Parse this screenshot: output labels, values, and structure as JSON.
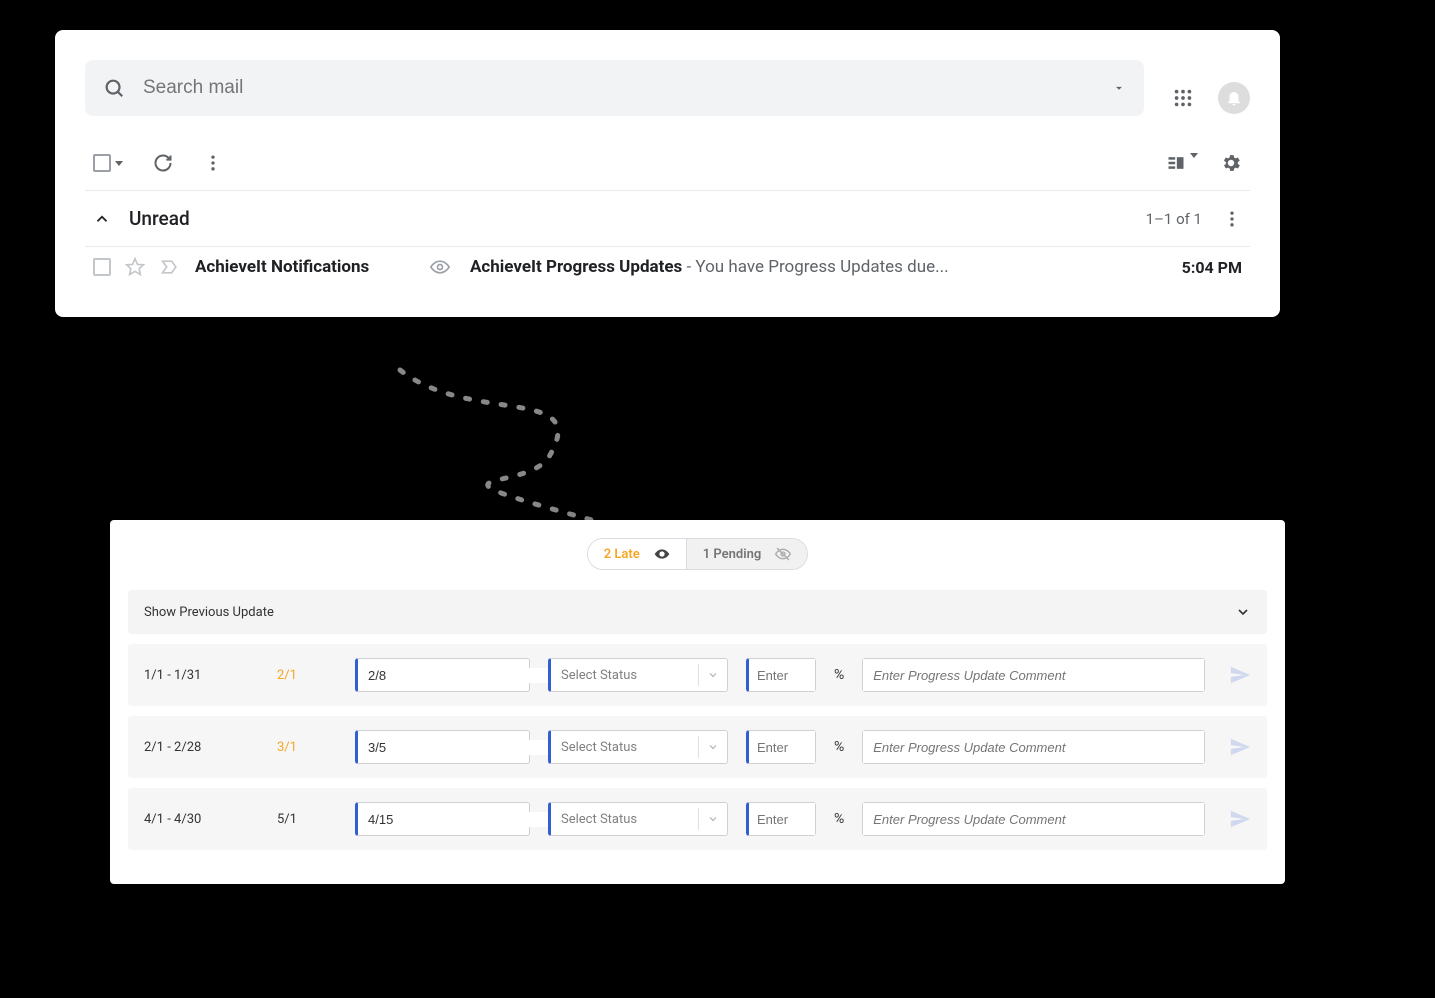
{
  "email": {
    "search_placeholder": "Search mail",
    "section_title": "Unread",
    "section_count": "1–1 of 1",
    "row": {
      "sender": "AchieveIt Notifications",
      "subject": "AchieveIt Progress Updates",
      "separator": " - ",
      "snippet": "You have Progress Updates due...",
      "time": "5:04 PM"
    }
  },
  "progress": {
    "late_label": "2 Late",
    "pending_label": "1 Pending",
    "prev_label": "Show Previous Update",
    "status_placeholder": "Select Status",
    "enter_placeholder": "Enter",
    "percent_label": "%",
    "comment_placeholder": "Enter Progress Update Comment",
    "rows": [
      {
        "range": "1/1 - 1/31",
        "due": "2/1",
        "late": true,
        "date": "2/8"
      },
      {
        "range": "2/1 - 2/28",
        "due": "3/1",
        "late": true,
        "date": "3/5"
      },
      {
        "range": "4/1 - 4/30",
        "due": "5/1",
        "late": false,
        "date": "4/15"
      }
    ]
  }
}
